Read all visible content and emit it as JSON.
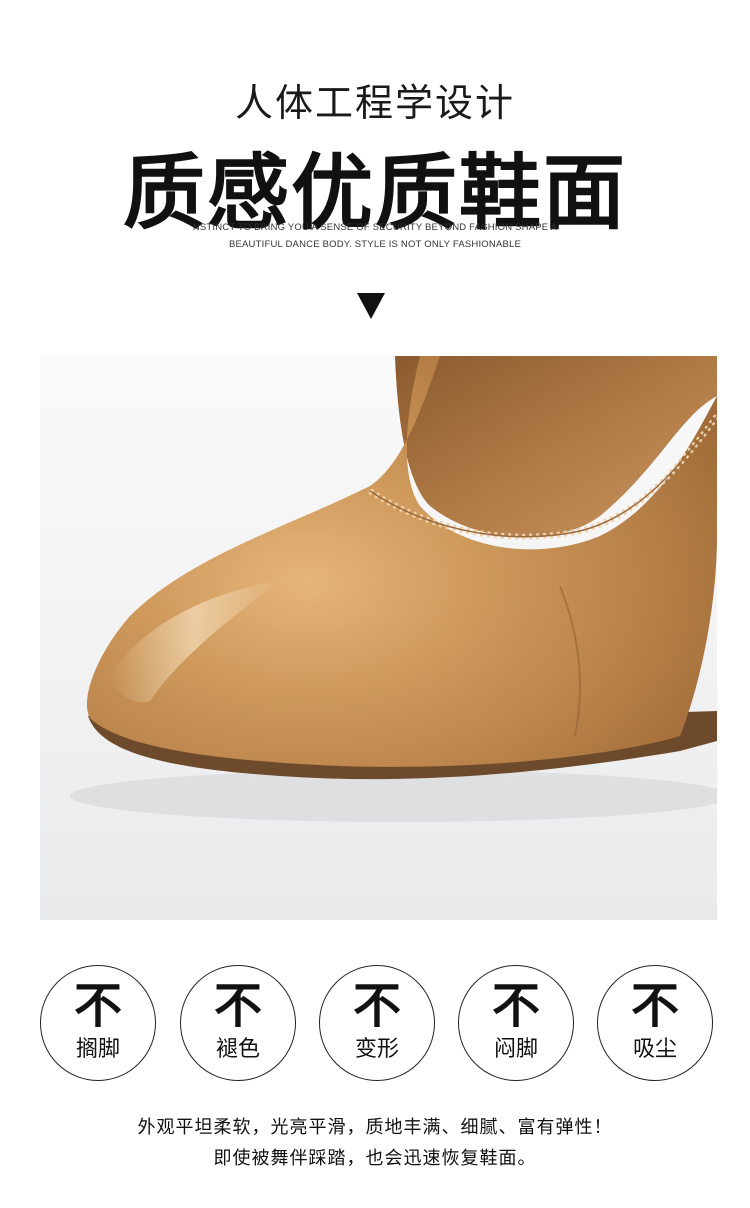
{
  "header": {
    "subtitle": "人体工程学设计",
    "title": "质感优质鞋面",
    "english_line1": "NSTINCT TO BRING YOU A SENSE OF SECURITY BEYOND FASHION SHAPE A",
    "english_line2": "BEAUTIFUL DANCE BODY. STYLE IS NOT ONLY FASHIONABLE"
  },
  "arrow_icon": "down-triangle-icon",
  "photo": {
    "subject": "shoe-toe-photo",
    "colors": {
      "leather": "#c58d4f",
      "sole": "#6e4a2c",
      "background": "#f3f3f4"
    }
  },
  "badges": [
    {
      "top": "不",
      "bottom": "搁脚"
    },
    {
      "top": "不",
      "bottom": "褪色"
    },
    {
      "top": "不",
      "bottom": "变形"
    },
    {
      "top": "不",
      "bottom": "闷脚"
    },
    {
      "top": "不",
      "bottom": "吸尘"
    }
  ],
  "description": {
    "line1": "外观平坦柔软，光亮平滑，质地丰满、细腻、富有弹性！",
    "line2": "即使被舞伴踩踏，也会迅速恢复鞋面。"
  }
}
